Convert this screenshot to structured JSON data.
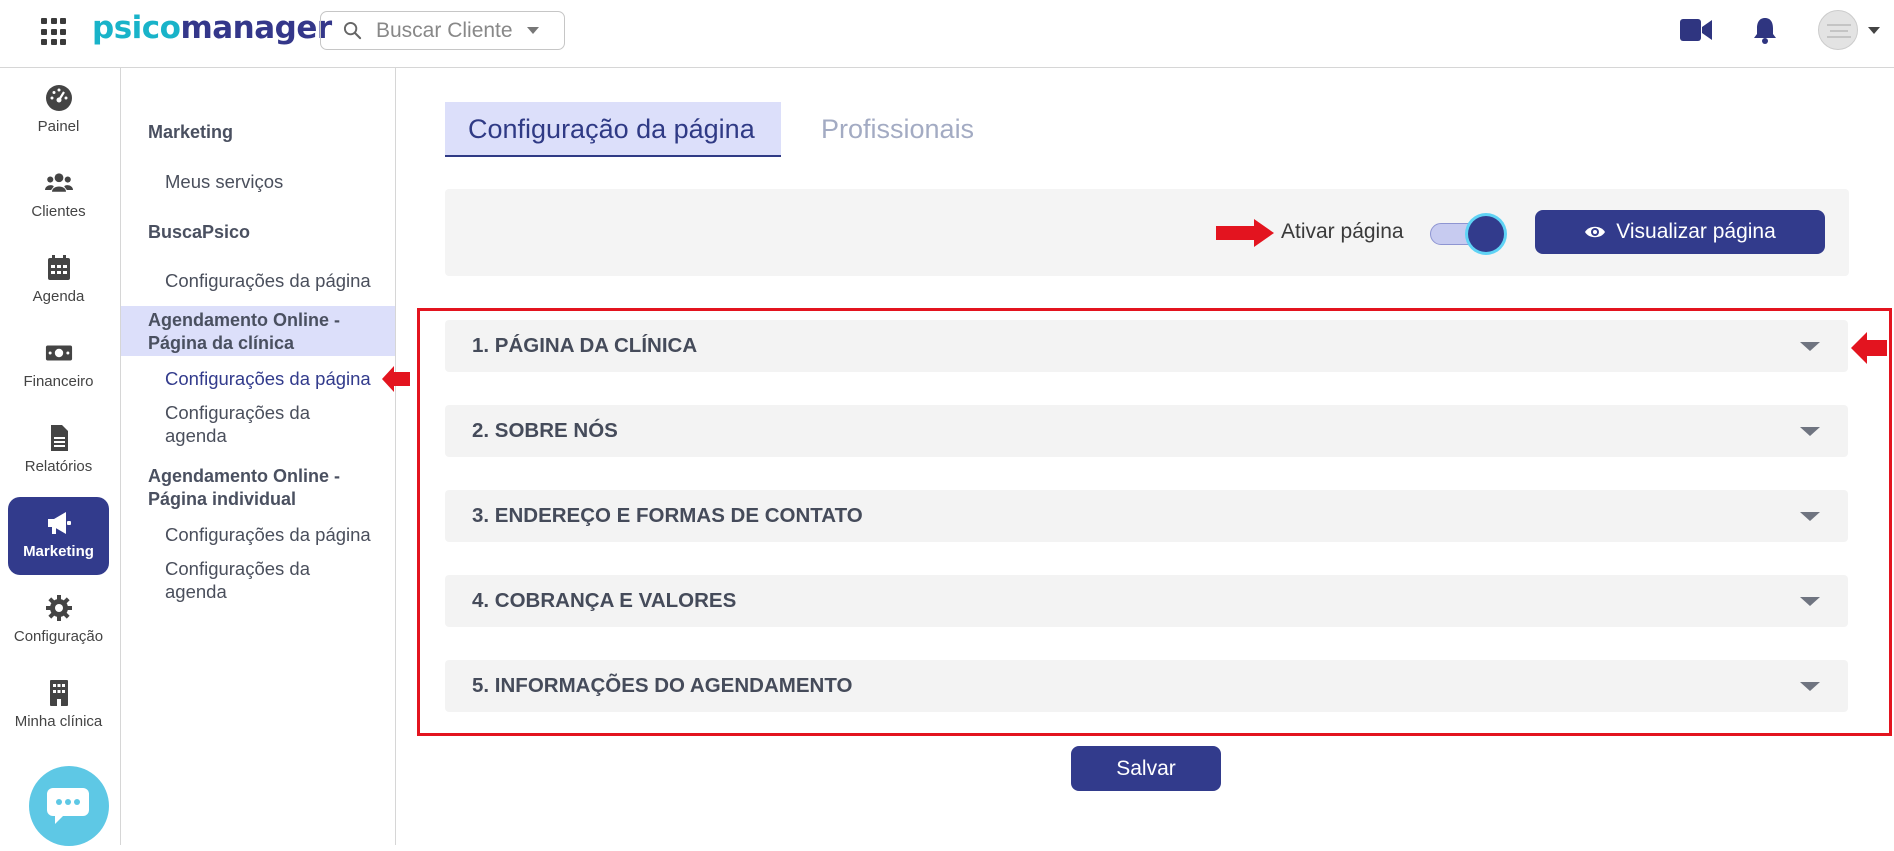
{
  "header": {
    "logo_part1": "psico",
    "logo_part2": "manager",
    "search_placeholder": "Buscar Cliente"
  },
  "rail": {
    "items": [
      {
        "label": "Painel",
        "icon": "dashboard-icon"
      },
      {
        "label": "Clientes",
        "icon": "users-icon"
      },
      {
        "label": "Agenda",
        "icon": "calendar-icon"
      },
      {
        "label": "Financeiro",
        "icon": "money-icon"
      },
      {
        "label": "Relatórios",
        "icon": "report-icon"
      },
      {
        "label": "Marketing",
        "icon": "megaphone-icon",
        "active": true
      },
      {
        "label": "Configuração",
        "icon": "gear-icon"
      },
      {
        "label": "Minha clínica",
        "icon": "building-icon"
      }
    ]
  },
  "submenu": {
    "group1": "Marketing",
    "group1_link1": "Meus serviços",
    "group2": "BuscaPsico",
    "group2_link1": "Configurações da página",
    "group3_line1": "Agendamento Online -",
    "group3_line2": "Página da clínica",
    "group3_link1": "Configurações da página",
    "group3_link2_line1": "Configurações da",
    "group3_link2_line2": "agenda",
    "group4_line1": "Agendamento Online -",
    "group4_line2": "Página individual",
    "group4_link1": "Configurações da página",
    "group4_link2_line1": "Configurações da",
    "group4_link2_line2": "agenda"
  },
  "tabs": {
    "active": "Configuração da página",
    "inactive": "Profissionais"
  },
  "actions": {
    "activate_label": "Ativar página",
    "toggle_on": true,
    "view_button": "Visualizar página"
  },
  "sections": [
    "1. PÁGINA DA CLÍNICA",
    "2. SOBRE NÓS",
    "3. ENDEREÇO E FORMAS DE CONTATO",
    "4. COBRANÇA E VALORES",
    "5. INFORMAÇÕES DO AGENDAMENTO"
  ],
  "save_button": "Salvar",
  "colors": {
    "primary": "#323b8c",
    "accent": "#19b3c9",
    "highlight": "#dcdffa",
    "annotation_red": "#e3141f"
  }
}
